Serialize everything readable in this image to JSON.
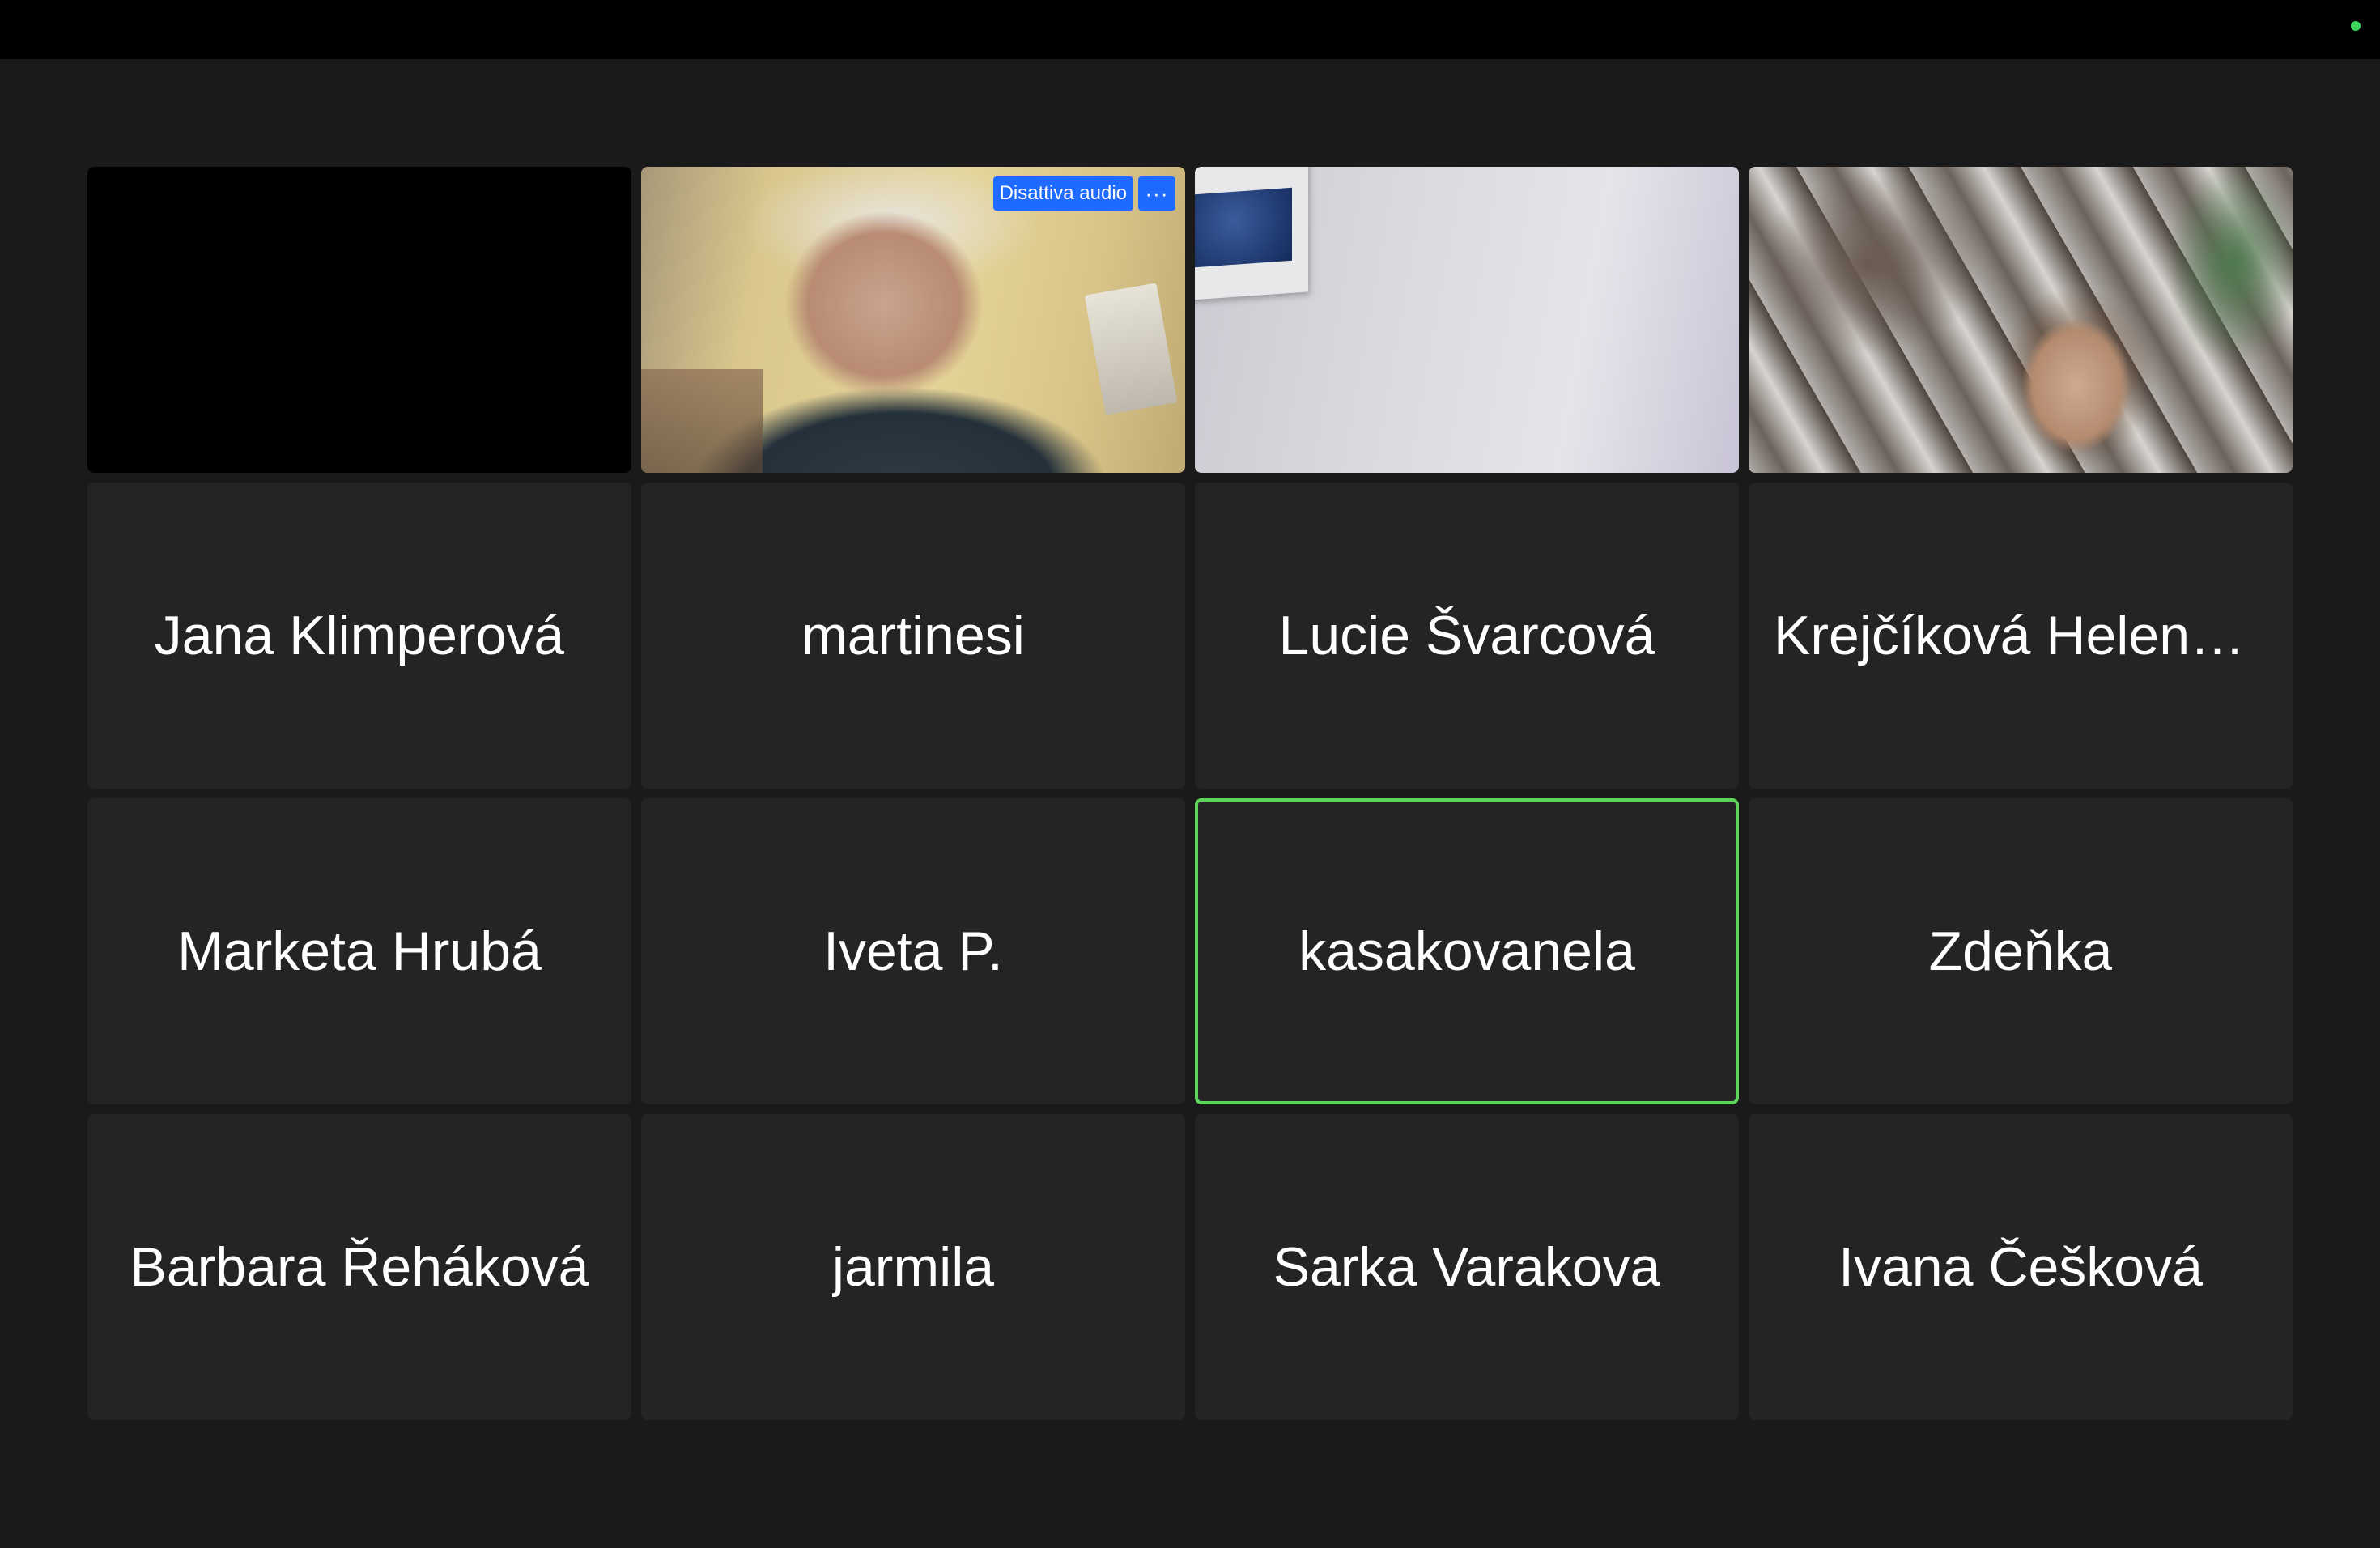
{
  "status": {
    "indicator_color": "#3ed35a"
  },
  "video_tiles": {
    "unmute_button_label": "Disattiva audio",
    "more_button_label": "···"
  },
  "participants": [
    {
      "name": "Jana Klimperová"
    },
    {
      "name": "martinesi"
    },
    {
      "name": "Lucie Švarcová"
    },
    {
      "name": "Krejčíková Helena,..."
    },
    {
      "name": "Marketa Hrubá"
    },
    {
      "name": "Iveta P."
    },
    {
      "name": "kasakovanela"
    },
    {
      "name": "Zdeňka"
    },
    {
      "name": "Barbara Řeháková"
    },
    {
      "name": "jarmila"
    },
    {
      "name": "Sarka Varakova"
    },
    {
      "name": "Ivana Češková"
    }
  ],
  "colors": {
    "active_speaker_border": "#5fd45b",
    "button_blue": "#1f6bff",
    "tile_bg": "#242424",
    "page_bg": "#1a1a1a"
  }
}
